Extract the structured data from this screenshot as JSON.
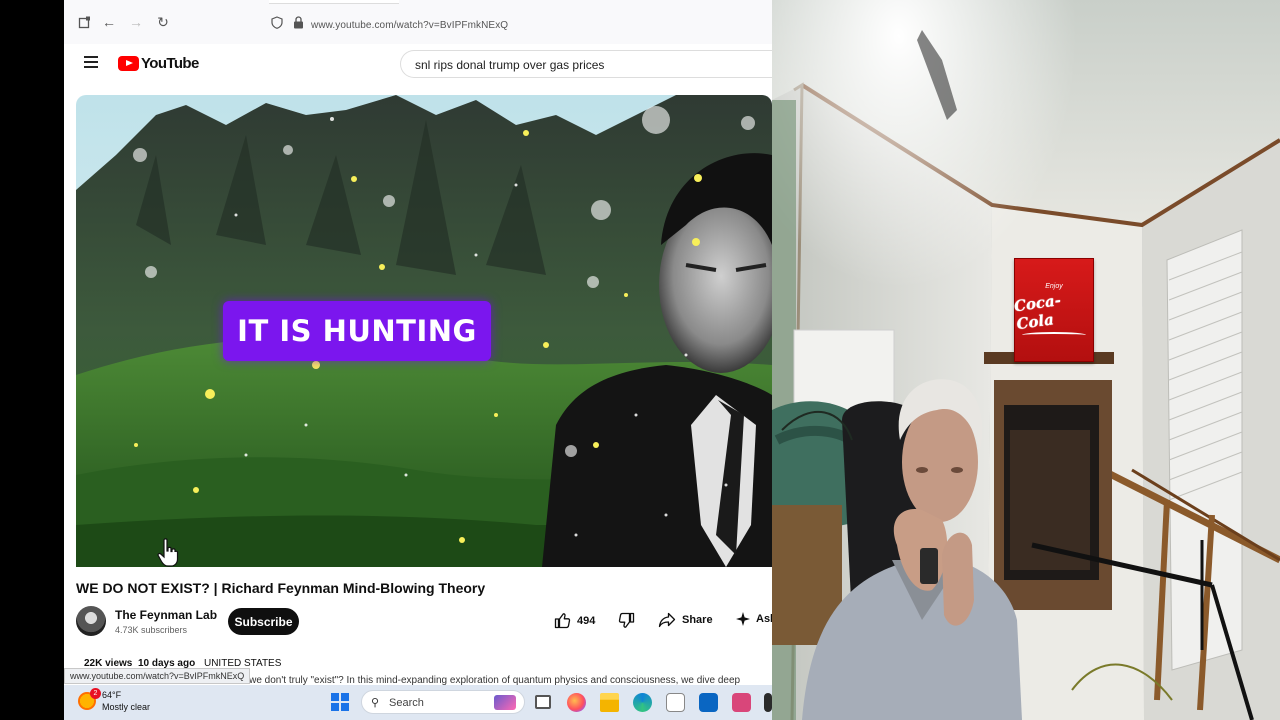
{
  "browser": {
    "url": "www.youtube.com/watch?v=BvIPFmkNExQ",
    "status_url": "www.youtube.com/watch?v=BvIPFmkNExQ"
  },
  "youtube": {
    "logo_text": "YouTube",
    "search_query": "snl rips donal trump over gas prices",
    "video": {
      "overlay_caption": "IT IS HUNTING",
      "title": "WE DO NOT EXIST? | Richard Feynman Mind-Blowing Theory",
      "views": "22K views",
      "age": "10 days ago",
      "country": "UNITED STATES",
      "description_snippet": "at we don't truly \"exist\"? In this mind-expanding exploration of quantum physics and consciousness, we dive deep"
    },
    "channel": {
      "name": "The Feynman Lab",
      "subscribers": "4.73K subscribers",
      "subscribe_label": "Subscribe"
    },
    "actions": {
      "likes": "494",
      "share_label": "Share",
      "ask_label": "Ask"
    }
  },
  "taskbar": {
    "weather_badge": "2",
    "temperature": "64°F",
    "condition": "Mostly clear",
    "search_label": "Search"
  },
  "webcam": {
    "sign_tagline": "Enjoy",
    "sign_brand": "Coca-Cola"
  },
  "colors": {
    "youtube_red": "#ff0000",
    "caption_purple": "#7b16ee",
    "subscribe_black": "#0f0f0f",
    "taskbar_bg": "#dfe7f2"
  },
  "icons": [
    "tab-icon",
    "back-arrow-icon",
    "forward-arrow-icon",
    "reload-icon",
    "shield-icon",
    "lock-icon",
    "hamburger-menu-icon",
    "youtube-play-icon",
    "thumbs-up-icon",
    "thumbs-down-icon",
    "share-arrow-icon",
    "sparkle-icon",
    "hand-cursor-icon",
    "windows-start-icon",
    "search-icon",
    "firefox-icon",
    "file-explorer-icon",
    "edge-icon",
    "store-icon",
    "weather-icon"
  ]
}
